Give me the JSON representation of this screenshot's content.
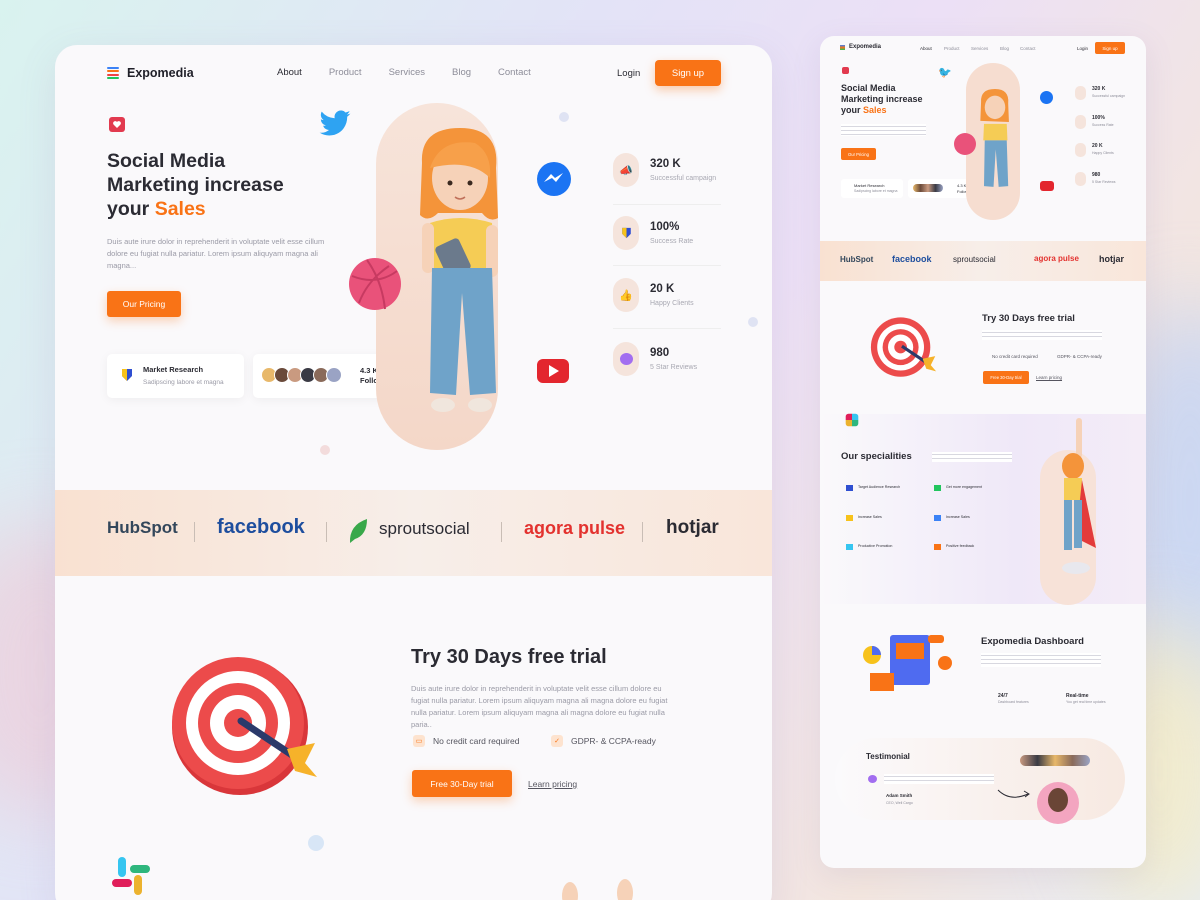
{
  "colors": {
    "accent": "#f97316",
    "text": "#2b2b33",
    "muted": "#9a9aa6"
  },
  "nav": {
    "brand": "Expomedia",
    "links": [
      "About",
      "Product",
      "Services",
      "Blog",
      "Contact"
    ],
    "login": "Login",
    "signup": "Sign up"
  },
  "hero": {
    "title_line1": "Social Media",
    "title_line2": "Marketing increase",
    "title_line3_prefix": "your ",
    "title_highlight": "Sales",
    "description": "Duis aute irure dolor in reprehenderit in voluptate velit esse cillum dolore eu fugiat nulla pariatur. Lorem ipsum aliquyam magna ali  magna...",
    "cta": "Our Pricing",
    "research_card": {
      "title": "Market Research",
      "subtitle": "Sadipscing labore et magna"
    },
    "follow_card": {
      "count": "4.3 K",
      "label": "Follow"
    }
  },
  "stats": [
    {
      "value": "320 K",
      "label": "Successful campaign",
      "icon": "megaphone-icon"
    },
    {
      "value": "100%",
      "label": "Success Rate",
      "icon": "shield-icon"
    },
    {
      "value": "20 K",
      "label": "Happy Clients",
      "icon": "thumbs-up-icon"
    },
    {
      "value": "980",
      "label": "5 Star Reviews",
      "icon": "chat-icon"
    }
  ],
  "brands": [
    "HubSpot",
    "facebook",
    "sproutsocial",
    "agora pulse",
    "hotjar"
  ],
  "trial": {
    "title": "Try 30 Days free trial",
    "description": "Duis aute irure dolor in reprehenderit in voluptate velit esse cillum dolore eu fugiat nulla pariatur. Lorem ipsum aliquyam magna ali  magna dolore eu fugiat nulla pariatur. Lorem ipsum aliquyam magna ali  magna dolore eu fugiat nulla paria..",
    "feature1": "No credit card required",
    "feature2": "GDPR- & CCPA-ready",
    "cta": "Free 30-Day trial",
    "link": "Learn pricing"
  },
  "mini": {
    "brand": "Expomedia",
    "links": [
      "About",
      "Product",
      "Services",
      "Blog",
      "Contact"
    ],
    "login": "Login",
    "signup": "Sign up",
    "hero_l1": "Social Media",
    "hero_l2": "Marketing increase",
    "hero_l3": "your ",
    "hero_hl": "Sales",
    "cta": "Our Pricing",
    "research": "Market Research",
    "research_sub": "Sadipscing labore et magna",
    "follow_count": "4.3 K",
    "follow_label": "Follow",
    "stats": [
      "320 K",
      "100%",
      "20 K",
      "980"
    ],
    "stat_labels": [
      "Successful campaign",
      "Success Rate",
      "Happy Clients",
      "5 Star Reviews"
    ],
    "brands": [
      "HubSpot",
      "facebook",
      "sproutsocial",
      "agora pulse",
      "hotjar"
    ],
    "trial_title": "Try 30 Days free trial",
    "trial_f1": "No credit card required",
    "trial_f2": "GDPR- & CCPA-ready",
    "trial_cta": "Free 30-Day trial",
    "trial_link": "Learn pricing",
    "specialities_title": "Our specialities",
    "specialities": [
      "Target Audience Research",
      "Get more engagement",
      "Increase Sales",
      "Increase Sales",
      "Productive Promotion",
      "Positive feedback"
    ],
    "dashboard_title": "Expomedia Dashboard",
    "dash_f1": "24/7",
    "dash_f1_sub": "Dashboard features",
    "dash_f2": "Real-time",
    "dash_f2_sub": "You get real time updates",
    "testimonial_title": "Testimonial",
    "testimonial_name": "Adam Smith",
    "testimonial_role": "CEO, Well Cargo"
  }
}
